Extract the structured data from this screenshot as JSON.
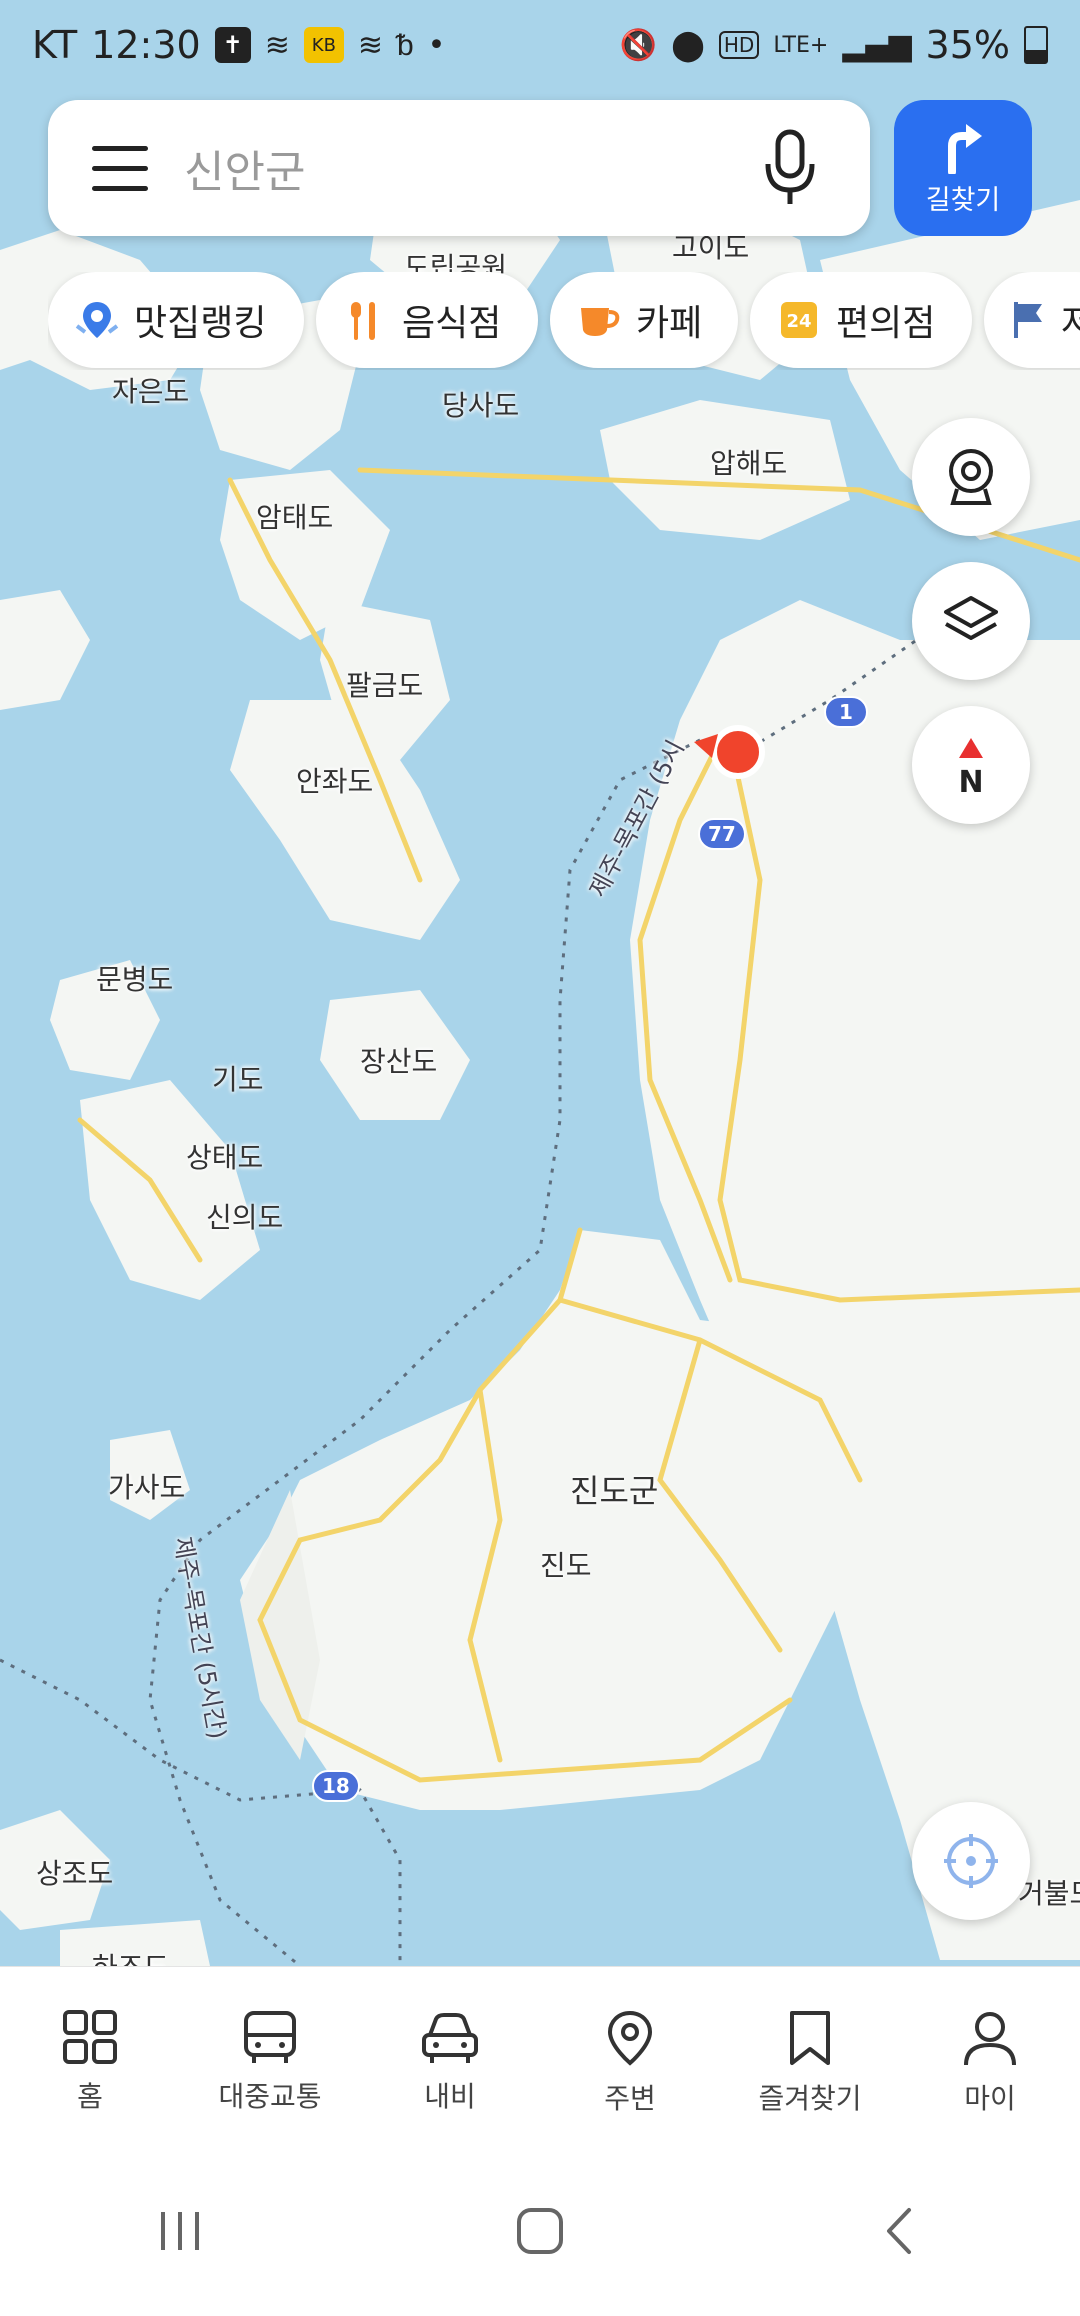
{
  "status_bar": {
    "carrier": "KT",
    "time": "12:30",
    "battery": "35%",
    "network": "LTE+"
  },
  "search": {
    "placeholder": "신안군"
  },
  "route_button": {
    "label": "길찾기"
  },
  "chips": [
    {
      "label": "맛집랭킹",
      "icon": "map-pin-rank-icon"
    },
    {
      "label": "음식점",
      "icon": "utensils-icon"
    },
    {
      "label": "카페",
      "icon": "coffee-cup-icon"
    },
    {
      "label": "편의점",
      "icon": "convenience-24-icon"
    },
    {
      "label": "저",
      "icon": "flag-icon"
    }
  ],
  "map": {
    "labels": [
      {
        "text": "자은도"
      },
      {
        "text": "당사도"
      },
      {
        "text": "압해도"
      },
      {
        "text": "암태도"
      },
      {
        "text": "팔금도"
      },
      {
        "text": "안좌도"
      },
      {
        "text": "문병도"
      },
      {
        "text": "장산도"
      },
      {
        "text": "기도"
      },
      {
        "text": "상태도"
      },
      {
        "text": "신의도"
      },
      {
        "text": "가사도"
      },
      {
        "text": "진도군"
      },
      {
        "text": "진도"
      },
      {
        "text": "상조도"
      },
      {
        "text": "하조도"
      },
      {
        "text": "거불도"
      },
      {
        "text": "고이도"
      },
      {
        "text": "도립공원"
      }
    ],
    "ferry_route_1": "제주-목포간 (5시",
    "ferry_route_2": "제주-목포간 (5시간)",
    "road_shields": [
      "1",
      "77",
      "18"
    ]
  },
  "bottom_nav": [
    {
      "label": "홈",
      "icon": "grid-home-icon"
    },
    {
      "label": "대중교통",
      "icon": "bus-icon"
    },
    {
      "label": "내비",
      "icon": "car-icon"
    },
    {
      "label": "주변",
      "icon": "location-pin-icon"
    },
    {
      "label": "즐겨찾기",
      "icon": "bookmark-icon"
    },
    {
      "label": "마이",
      "icon": "person-icon"
    }
  ],
  "colors": {
    "water": "#a9d4ea",
    "land": "#f4f6f3",
    "road": "#f3d46a",
    "accent": "#2a6ff0",
    "marker": "#f0442c"
  }
}
